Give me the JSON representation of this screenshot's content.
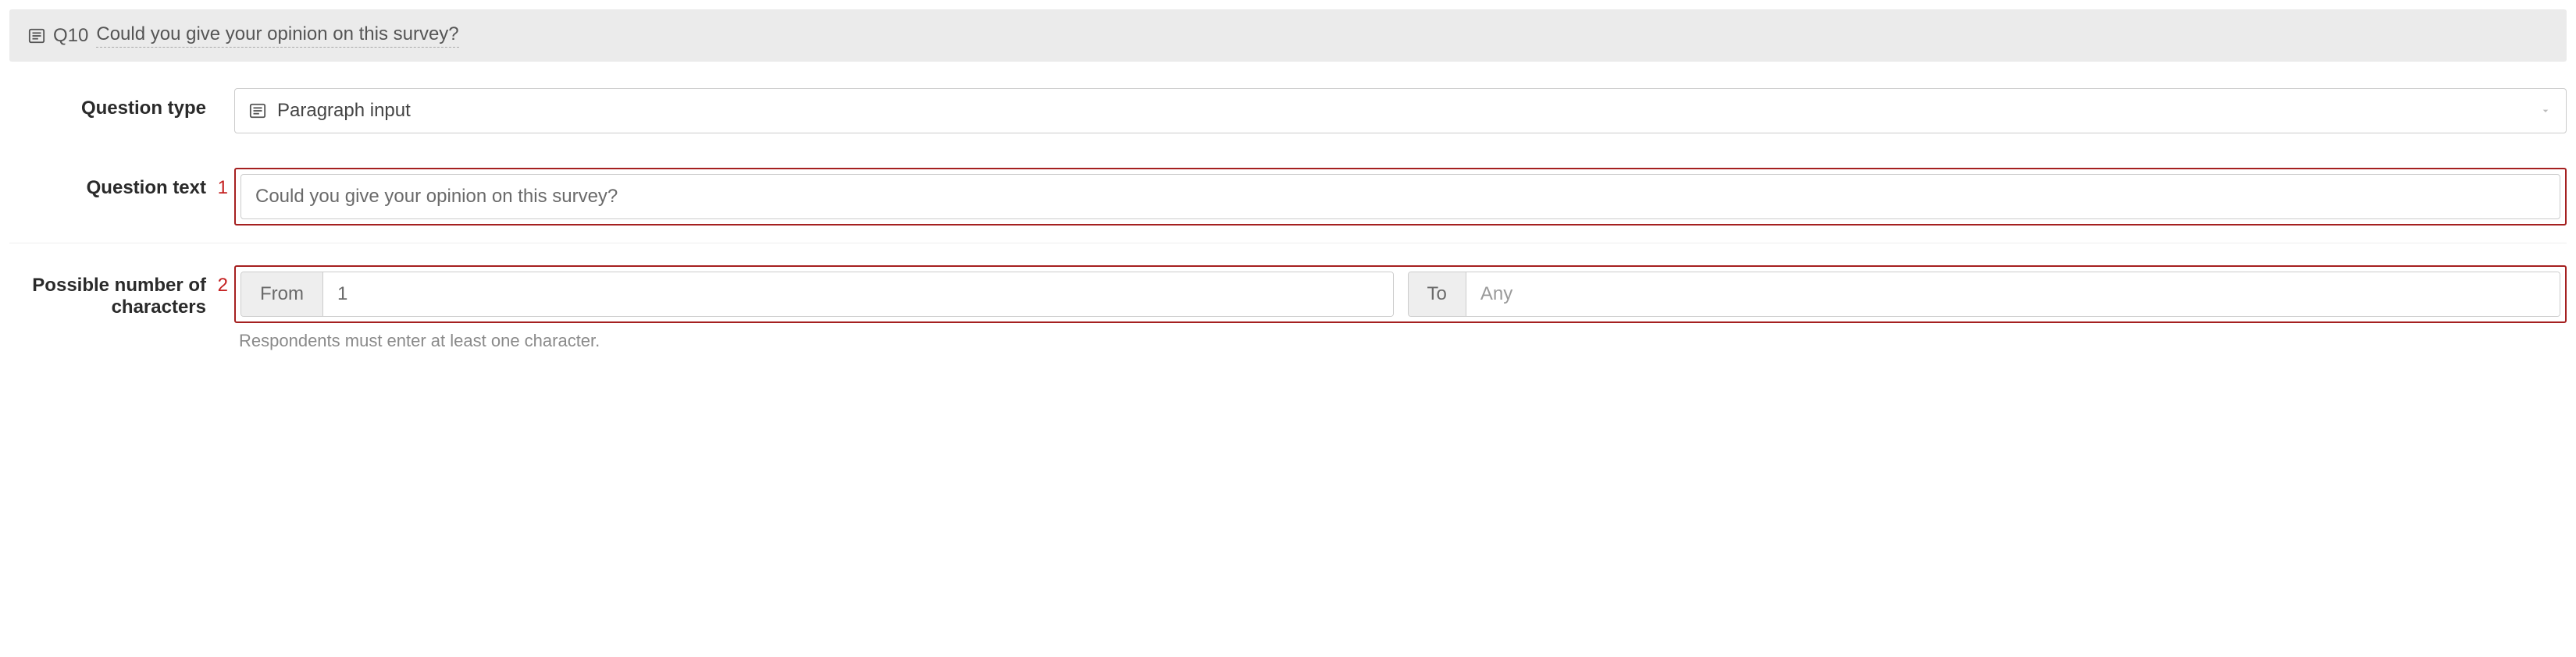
{
  "header": {
    "qid": "Q10",
    "question_preview": "Could you give your opinion on this survey?"
  },
  "labels": {
    "question_type": "Question type",
    "question_text": "Question text",
    "possible_chars": "Possible number of characters"
  },
  "markers": {
    "question_text": "1",
    "possible_chars": "2"
  },
  "question_type": {
    "selected_label": "Paragraph input"
  },
  "question_text": {
    "value": "Could you give your opinion on this survey?"
  },
  "char_limits": {
    "from_label": "From",
    "from_value": "1",
    "to_label": "To",
    "to_placeholder": "Any",
    "to_value": ""
  },
  "help": {
    "chars_hint": "Respondents must enter at least one character."
  }
}
